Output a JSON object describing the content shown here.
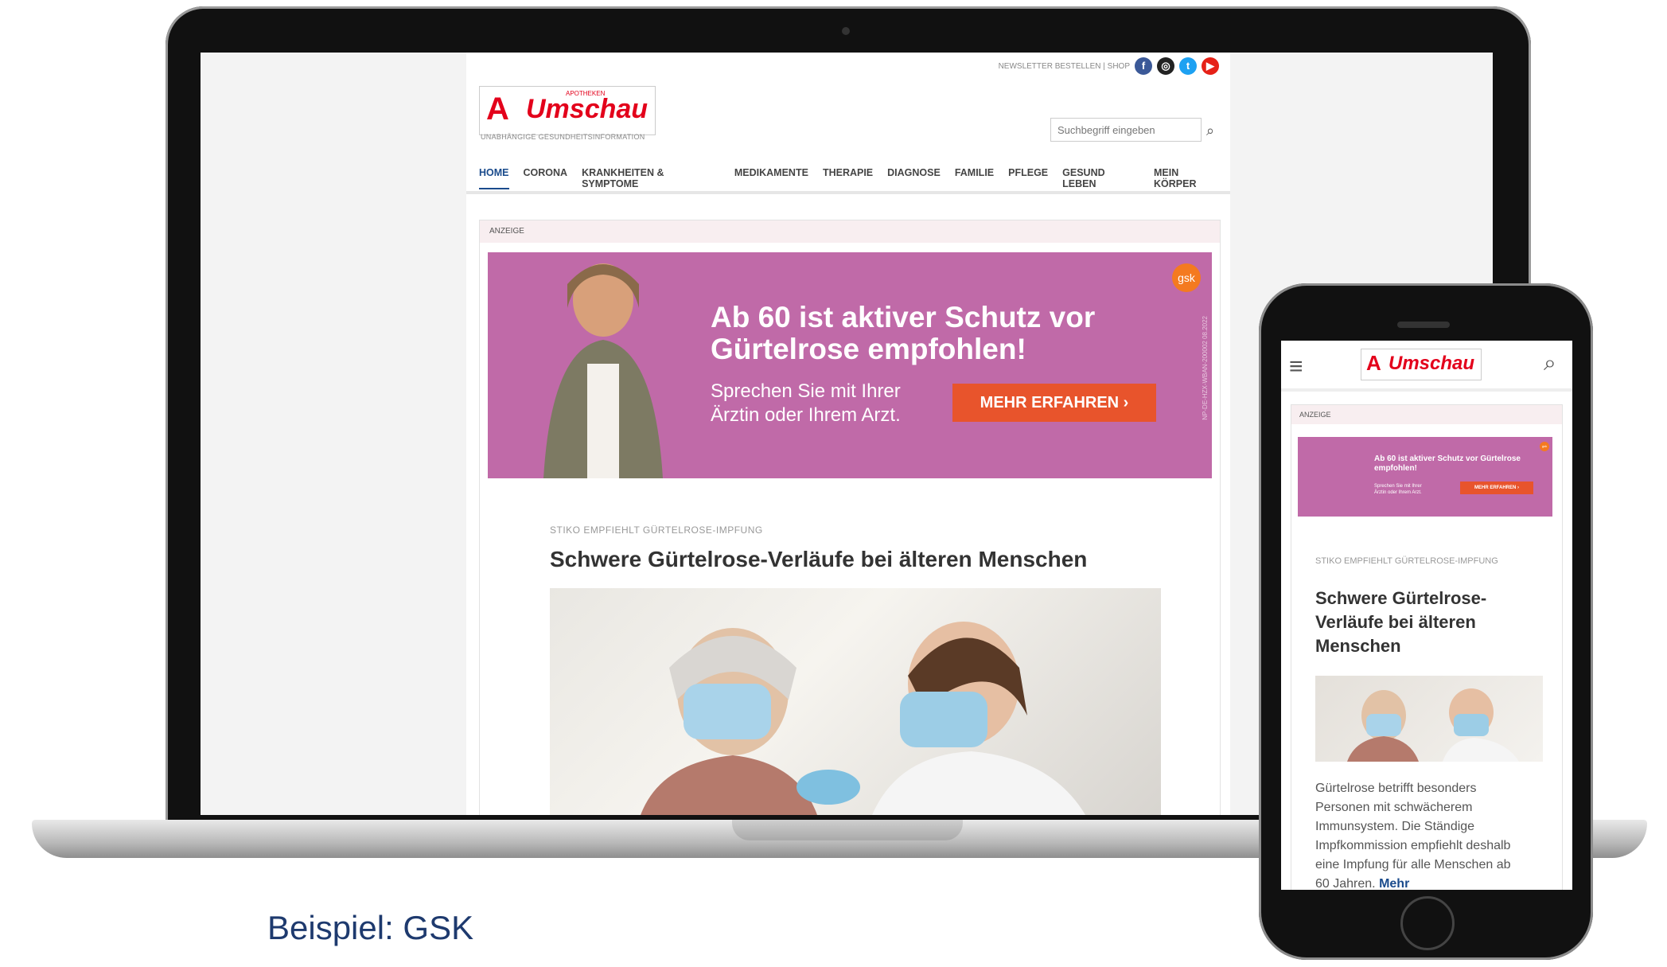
{
  "site": {
    "top_links": "NEWSLETTER BESTELLEN | SHOP",
    "logo_small": "APOTHEKEN",
    "logo": "Umschau",
    "tagline": "UNABHÄNGIGE GESUNDHEITSINFORMATION",
    "search_placeholder": "Suchbegriff eingeben",
    "nav": [
      "HOME",
      "CORONA",
      "KRANKHEITEN & SYMPTOME",
      "MEDIKAMENTE",
      "THERAPIE",
      "DIAGNOSE",
      "FAMILIE",
      "PFLEGE",
      "GESUND LEBEN",
      "MEIN KÖRPER"
    ],
    "ad_label": "ANZEIGE"
  },
  "banner": {
    "title": "Ab 60 ist aktiver Schutz vor Gürtelrose empfohlen!",
    "subtitle": "Sprechen Sie mit Ihrer Ärztin oder Ihrem Arzt.",
    "button": "MEHR ERFAHREN ›",
    "brand": "gsk",
    "legal": "NP-DE-HZX-WBAN-200002 08.2022"
  },
  "article": {
    "kicker": "STIKO EMPFIEHLT GÜRTELROSE-IMPFUNG",
    "headline": "Schwere Gürtelrose-Verläufe bei älteren Menschen",
    "mobile_headline": "Schwere Gürtelrose-Verläufe bei älteren Menschen",
    "teaser": "Gürtelrose betrifft besonders Personen mit schwächerem Immunsystem. Die Ständige Impfkommission empfiehlt deshalb eine Impfung für alle Menschen ab 60 Jahren.",
    "more": "Mehr"
  },
  "caption": "Beispiel: GSK",
  "colors": {
    "brand_red": "#e3001b",
    "banner": "#c06aa8",
    "cta": "#e8542c",
    "nav_active": "#1a4b8c",
    "caption": "#1e3a6e"
  },
  "icons": [
    "facebook-icon",
    "instagram-icon",
    "twitter-icon",
    "youtube-icon",
    "search-icon",
    "menu-icon"
  ]
}
